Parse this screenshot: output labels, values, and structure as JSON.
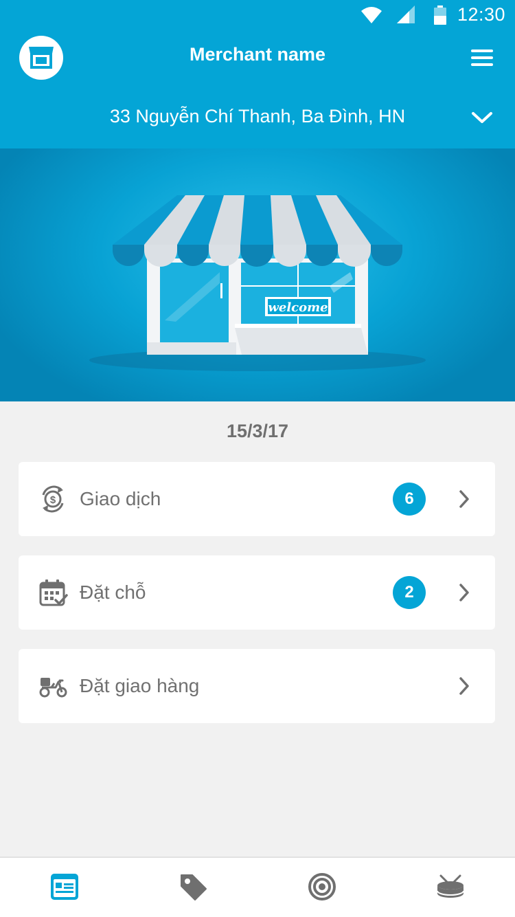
{
  "status_bar": {
    "time": "12:30",
    "icons": [
      "wifi-icon",
      "signal-icon",
      "battery-icon"
    ]
  },
  "header": {
    "merchant_name": "Merchant name",
    "address": "33 Nguyễn Chí Thanh, Ba Đình, HN",
    "icons": {
      "left": "store-icon",
      "right": "hamburger-menu-icon",
      "address": "chevron-down-icon"
    }
  },
  "hero": {
    "sign_text": "welcome"
  },
  "date": "15/3/17",
  "menu": [
    {
      "label": "Giao dịch",
      "count": "6",
      "icon": "dollar-exchange-icon"
    },
    {
      "label": "Đặt chỗ",
      "count": "2",
      "icon": "calendar-check-icon"
    },
    {
      "label": "Đặt giao hàng",
      "icon": "delivery-scooter-icon"
    }
  ],
  "bottom_nav": [
    {
      "icon": "dashboard-card-icon",
      "active": true
    },
    {
      "icon": "price-tag-icon",
      "active": false
    },
    {
      "icon": "target-icon",
      "active": false
    },
    {
      "icon": "drum-icon",
      "active": false
    }
  ],
  "colors": {
    "primary": "#04a5d6",
    "background": "#f1f1f1",
    "card": "#ffffff",
    "text_muted": "#707070"
  }
}
